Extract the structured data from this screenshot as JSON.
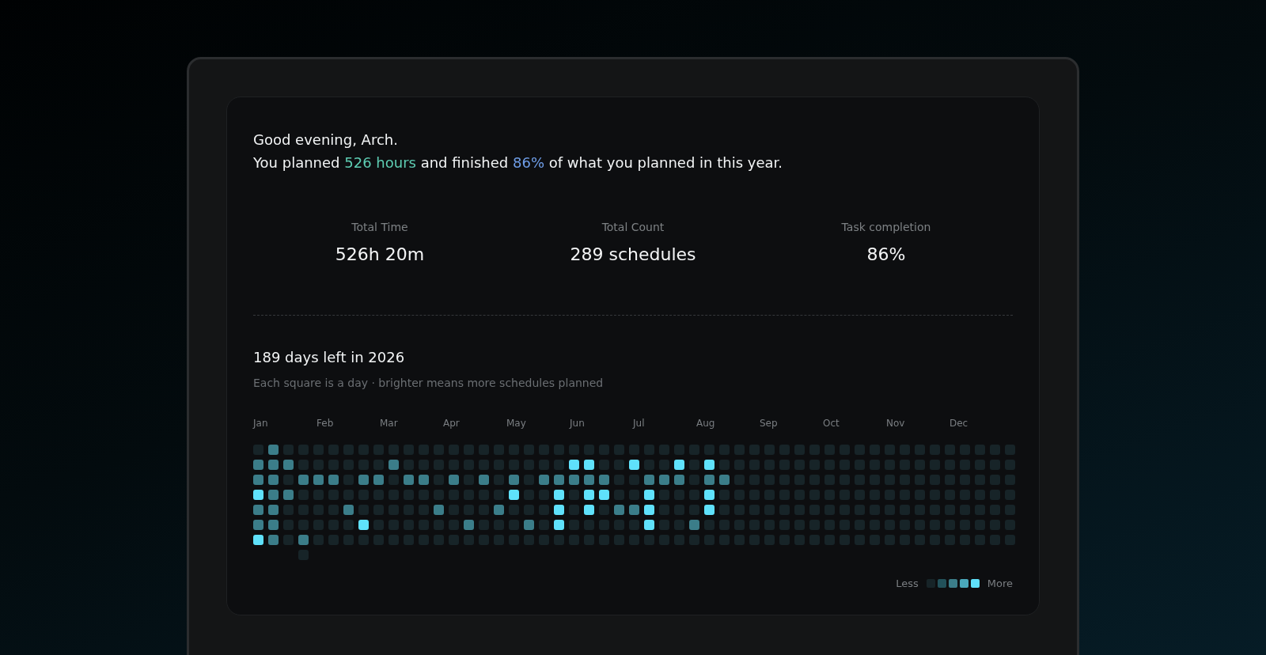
{
  "greeting": "Good evening, Arch.",
  "summary": [
    {
      "text": "You planned ",
      "color": "#f2f4f5"
    },
    {
      "text": "526 hours",
      "color": "#5ecdb3"
    },
    {
      "text": " and finished ",
      "color": "#f2f4f5"
    },
    {
      "text": "86%",
      "color": "#6f9ee8"
    },
    {
      "text": " of what you planned in this year.",
      "color": "#f2f4f5"
    }
  ],
  "stats": [
    {
      "label": "Total Time",
      "value": "526h 20m"
    },
    {
      "label": "Total Count",
      "value": "289 schedules"
    },
    {
      "label": "Task completion",
      "value": "86%"
    }
  ],
  "heatmap": {
    "title": "189 days left in 2026",
    "subtitle": "Each square is a day · brighter means more schedules planned",
    "months": [
      "Jan",
      "Feb",
      "Mar",
      "Apr",
      "May",
      "Jun",
      "Jul",
      "Aug",
      "Sep",
      "Oct",
      "Nov",
      "Dec"
    ],
    "weeks": [
      [
        {
          "color": "#172428"
        },
        {
          "color": "#3b7d89"
        },
        {
          "color": "#3b7d89"
        },
        {
          "color": "#5fe1fb"
        },
        {
          "color": "#3b7d89"
        },
        {
          "color": "#3b7d89"
        },
        {
          "color": "#5fe1fb"
        }
      ],
      [
        {
          "color": "#3b7d89"
        },
        {
          "color": "#3b7d89"
        },
        {
          "color": "#3b7d89"
        },
        {
          "color": "#3b7d89"
        },
        {
          "color": "#3b7d89"
        },
        {
          "color": "#3b7d89"
        },
        {
          "color": "#3b7d89"
        }
      ],
      [
        {
          "color": "#172428"
        },
        {
          "color": "#3b7d89"
        },
        {
          "color": "#172428"
        },
        {
          "color": "#3b7d89"
        },
        {
          "color": "#172428"
        },
        {
          "color": "#172428"
        },
        {
          "color": "#172428"
        }
      ],
      [
        {
          "color": "#172428"
        },
        {
          "color": "#172428"
        },
        {
          "color": "#3b7d89"
        },
        {
          "color": "#172428"
        },
        {
          "color": "#172428"
        },
        {
          "color": "#172428"
        },
        {
          "color": "#3b7d89"
        },
        {
          "color": "#172428"
        }
      ],
      [
        {
          "color": "#172428"
        },
        {
          "color": "#172428"
        },
        {
          "color": "#3b7d89"
        },
        {
          "color": "#172428"
        },
        {
          "color": "#172428"
        },
        {
          "color": "#172428"
        },
        {
          "color": "#172428"
        }
      ],
      [
        {
          "color": "#172428"
        },
        {
          "color": "#172428"
        },
        {
          "color": "#3b7d89"
        },
        {
          "color": "#172428"
        },
        {
          "color": "#172428"
        },
        {
          "color": "#172428"
        },
        {
          "color": "#172428"
        }
      ],
      [
        {
          "color": "#172428"
        },
        {
          "color": "#172428"
        },
        {
          "color": "#172428"
        },
        {
          "color": "#172428"
        },
        {
          "color": "#3b7d89"
        },
        {
          "color": "#172428"
        },
        {
          "color": "#172428"
        }
      ],
      [
        {
          "color": "#172428"
        },
        {
          "color": "#172428"
        },
        {
          "color": "#3b7d89"
        },
        {
          "color": "#172428"
        },
        {
          "color": "#172428"
        },
        {
          "color": "#5fe1fb"
        },
        {
          "color": "#172428"
        }
      ],
      [
        {
          "color": "#172428"
        },
        {
          "color": "#172428"
        },
        {
          "color": "#3b7d89"
        },
        {
          "color": "#172428"
        },
        {
          "color": "#172428"
        },
        {
          "color": "#172428"
        },
        {
          "color": "#172428"
        }
      ],
      [
        {
          "color": "#172428"
        },
        {
          "color": "#3b7d89"
        },
        {
          "color": "#172428"
        },
        {
          "color": "#172428"
        },
        {
          "color": "#172428"
        },
        {
          "color": "#172428"
        },
        {
          "color": "#172428"
        }
      ],
      [
        {
          "color": "#172428"
        },
        {
          "color": "#172428"
        },
        {
          "color": "#3b7d89"
        },
        {
          "color": "#172428"
        },
        {
          "color": "#172428"
        },
        {
          "color": "#172428"
        },
        {
          "color": "#172428"
        }
      ],
      [
        {
          "color": "#172428"
        },
        {
          "color": "#172428"
        },
        {
          "color": "#3b7d89"
        },
        {
          "color": "#172428"
        },
        {
          "color": "#172428"
        },
        {
          "color": "#172428"
        },
        {
          "color": "#172428"
        }
      ],
      [
        {
          "color": "#172428"
        },
        {
          "color": "#172428"
        },
        {
          "color": "#172428"
        },
        {
          "color": "#172428"
        },
        {
          "color": "#3b7d89"
        },
        {
          "color": "#172428"
        },
        {
          "color": "#172428"
        }
      ],
      [
        {
          "color": "#172428"
        },
        {
          "color": "#172428"
        },
        {
          "color": "#3b7d89"
        },
        {
          "color": "#172428"
        },
        {
          "color": "#172428"
        },
        {
          "color": "#172428"
        },
        {
          "color": "#172428"
        }
      ],
      [
        {
          "color": "#172428"
        },
        {
          "color": "#172428"
        },
        {
          "color": "#172428"
        },
        {
          "color": "#172428"
        },
        {
          "color": "#172428"
        },
        {
          "color": "#3b7d89"
        },
        {
          "color": "#172428"
        }
      ],
      [
        {
          "color": "#172428"
        },
        {
          "color": "#172428"
        },
        {
          "color": "#3b7d89"
        },
        {
          "color": "#172428"
        },
        {
          "color": "#172428"
        },
        {
          "color": "#172428"
        },
        {
          "color": "#172428"
        }
      ],
      [
        {
          "color": "#172428"
        },
        {
          "color": "#172428"
        },
        {
          "color": "#172428"
        },
        {
          "color": "#172428"
        },
        {
          "color": "#3b7d89"
        },
        {
          "color": "#172428"
        },
        {
          "color": "#172428"
        }
      ],
      [
        {
          "color": "#172428"
        },
        {
          "color": "#172428"
        },
        {
          "color": "#3b7d89"
        },
        {
          "color": "#5fe1fb"
        },
        {
          "color": "#172428"
        },
        {
          "color": "#172428"
        },
        {
          "color": "#172428"
        }
      ],
      [
        {
          "color": "#172428"
        },
        {
          "color": "#172428"
        },
        {
          "color": "#172428"
        },
        {
          "color": "#172428"
        },
        {
          "color": "#172428"
        },
        {
          "color": "#3b7d89"
        },
        {
          "color": "#172428"
        }
      ],
      [
        {
          "color": "#172428"
        },
        {
          "color": "#172428"
        },
        {
          "color": "#3b7d89"
        },
        {
          "color": "#172428"
        },
        {
          "color": "#172428"
        },
        {
          "color": "#172428"
        },
        {
          "color": "#172428"
        }
      ],
      [
        {
          "color": "#172428"
        },
        {
          "color": "#172428"
        },
        {
          "color": "#3b7d89"
        },
        {
          "color": "#5fe1fb"
        },
        {
          "color": "#5fe1fb"
        },
        {
          "color": "#5fe1fb"
        },
        {
          "color": "#172428"
        }
      ],
      [
        {
          "color": "#172428"
        },
        {
          "color": "#5fe1fb"
        },
        {
          "color": "#3b7d89"
        },
        {
          "color": "#172428"
        },
        {
          "color": "#172428"
        },
        {
          "color": "#172428"
        },
        {
          "color": "#172428"
        }
      ],
      [
        {
          "color": "#172428"
        },
        {
          "color": "#5fe1fb"
        },
        {
          "color": "#3b7d89"
        },
        {
          "color": "#5fe1fb"
        },
        {
          "color": "#5fe1fb"
        },
        {
          "color": "#172428"
        },
        {
          "color": "#172428"
        }
      ],
      [
        {
          "color": "#172428"
        },
        {
          "color": "#172428"
        },
        {
          "color": "#3b7d89"
        },
        {
          "color": "#5fe1fb"
        },
        {
          "color": "#172428"
        },
        {
          "color": "#172428"
        },
        {
          "color": "#172428"
        }
      ],
      [
        {
          "color": "#172428"
        },
        {
          "color": "#172428"
        },
        {
          "color": "#172428"
        },
        {
          "color": "#172428"
        },
        {
          "color": "#3b7d89"
        },
        {
          "color": "#172428"
        },
        {
          "color": "#172428"
        }
      ],
      [
        {
          "color": "#172428"
        },
        {
          "color": "#5fe1fb"
        },
        {
          "color": "#172428"
        },
        {
          "color": "#172428"
        },
        {
          "color": "#3b7d89"
        },
        {
          "color": "#172428"
        },
        {
          "color": "#172428"
        }
      ],
      [
        {
          "color": "#172428"
        },
        {
          "color": "#172428"
        },
        {
          "color": "#3b7d89"
        },
        {
          "color": "#5fe1fb"
        },
        {
          "color": "#5fe1fb"
        },
        {
          "color": "#5fe1fb"
        },
        {
          "color": "#172428"
        }
      ],
      [
        {
          "color": "#172428"
        },
        {
          "color": "#172428"
        },
        {
          "color": "#3b7d89"
        },
        {
          "color": "#172428"
        },
        {
          "color": "#172428"
        },
        {
          "color": "#172428"
        },
        {
          "color": "#172428"
        }
      ],
      [
        {
          "color": "#172428"
        },
        {
          "color": "#5fe1fb"
        },
        {
          "color": "#3b7d89"
        },
        {
          "color": "#172428"
        },
        {
          "color": "#172428"
        },
        {
          "color": "#172428"
        },
        {
          "color": "#172428"
        }
      ],
      [
        {
          "color": "#172428"
        },
        {
          "color": "#172428"
        },
        {
          "color": "#172428"
        },
        {
          "color": "#172428"
        },
        {
          "color": "#172428"
        },
        {
          "color": "#3b7d89"
        },
        {
          "color": "#172428"
        }
      ],
      [
        {
          "color": "#172428"
        },
        {
          "color": "#5fe1fb"
        },
        {
          "color": "#3b7d89"
        },
        {
          "color": "#5fe1fb"
        },
        {
          "color": "#5fe1fb"
        },
        {
          "color": "#172428"
        },
        {
          "color": "#172428"
        }
      ],
      [
        {
          "color": "#172428"
        },
        {
          "color": "#172428"
        },
        {
          "color": "#3b7d89"
        },
        {
          "color": "#172428"
        },
        {
          "color": "#172428"
        },
        {
          "color": "#172428"
        },
        {
          "color": "#172428"
        }
      ],
      [
        {
          "color": "#172428"
        },
        {
          "color": "#172428"
        },
        {
          "color": "#172428"
        },
        {
          "color": "#172428"
        },
        {
          "color": "#172428"
        },
        {
          "color": "#172428"
        },
        {
          "color": "#172428"
        }
      ],
      [
        {
          "color": "#172428"
        },
        {
          "color": "#172428"
        },
        {
          "color": "#172428"
        },
        {
          "color": "#172428"
        },
        {
          "color": "#172428"
        },
        {
          "color": "#172428"
        },
        {
          "color": "#172428"
        }
      ],
      [
        {
          "color": "#172428"
        },
        {
          "color": "#172428"
        },
        {
          "color": "#172428"
        },
        {
          "color": "#172428"
        },
        {
          "color": "#172428"
        },
        {
          "color": "#172428"
        },
        {
          "color": "#172428"
        }
      ],
      [
        {
          "color": "#172428"
        },
        {
          "color": "#172428"
        },
        {
          "color": "#172428"
        },
        {
          "color": "#172428"
        },
        {
          "color": "#172428"
        },
        {
          "color": "#172428"
        },
        {
          "color": "#172428"
        }
      ],
      [
        {
          "color": "#172428"
        },
        {
          "color": "#172428"
        },
        {
          "color": "#172428"
        },
        {
          "color": "#172428"
        },
        {
          "color": "#172428"
        },
        {
          "color": "#172428"
        },
        {
          "color": "#172428"
        }
      ],
      [
        {
          "color": "#172428"
        },
        {
          "color": "#172428"
        },
        {
          "color": "#172428"
        },
        {
          "color": "#172428"
        },
        {
          "color": "#172428"
        },
        {
          "color": "#172428"
        },
        {
          "color": "#172428"
        }
      ],
      [
        {
          "color": "#172428"
        },
        {
          "color": "#172428"
        },
        {
          "color": "#172428"
        },
        {
          "color": "#172428"
        },
        {
          "color": "#172428"
        },
        {
          "color": "#172428"
        },
        {
          "color": "#172428"
        }
      ],
      [
        {
          "color": "#172428"
        },
        {
          "color": "#172428"
        },
        {
          "color": "#172428"
        },
        {
          "color": "#172428"
        },
        {
          "color": "#172428"
        },
        {
          "color": "#172428"
        },
        {
          "color": "#172428"
        }
      ],
      [
        {
          "color": "#172428"
        },
        {
          "color": "#172428"
        },
        {
          "color": "#172428"
        },
        {
          "color": "#172428"
        },
        {
          "color": "#172428"
        },
        {
          "color": "#172428"
        },
        {
          "color": "#172428"
        }
      ],
      [
        {
          "color": "#172428"
        },
        {
          "color": "#172428"
        },
        {
          "color": "#172428"
        },
        {
          "color": "#172428"
        },
        {
          "color": "#172428"
        },
        {
          "color": "#172428"
        },
        {
          "color": "#172428"
        }
      ],
      [
        {
          "color": "#172428"
        },
        {
          "color": "#172428"
        },
        {
          "color": "#172428"
        },
        {
          "color": "#172428"
        },
        {
          "color": "#172428"
        },
        {
          "color": "#172428"
        },
        {
          "color": "#172428"
        }
      ],
      [
        {
          "color": "#172428"
        },
        {
          "color": "#172428"
        },
        {
          "color": "#172428"
        },
        {
          "color": "#172428"
        },
        {
          "color": "#172428"
        },
        {
          "color": "#172428"
        },
        {
          "color": "#172428"
        }
      ],
      [
        {
          "color": "#172428"
        },
        {
          "color": "#172428"
        },
        {
          "color": "#172428"
        },
        {
          "color": "#172428"
        },
        {
          "color": "#172428"
        },
        {
          "color": "#172428"
        },
        {
          "color": "#172428"
        }
      ],
      [
        {
          "color": "#172428"
        },
        {
          "color": "#172428"
        },
        {
          "color": "#172428"
        },
        {
          "color": "#172428"
        },
        {
          "color": "#172428"
        },
        {
          "color": "#172428"
        },
        {
          "color": "#172428"
        }
      ],
      [
        {
          "color": "#172428"
        },
        {
          "color": "#172428"
        },
        {
          "color": "#172428"
        },
        {
          "color": "#172428"
        },
        {
          "color": "#172428"
        },
        {
          "color": "#172428"
        },
        {
          "color": "#172428"
        }
      ],
      [
        {
          "color": "#172428"
        },
        {
          "color": "#172428"
        },
        {
          "color": "#172428"
        },
        {
          "color": "#172428"
        },
        {
          "color": "#172428"
        },
        {
          "color": "#172428"
        },
        {
          "color": "#172428"
        }
      ],
      [
        {
          "color": "#172428"
        },
        {
          "color": "#172428"
        },
        {
          "color": "#172428"
        },
        {
          "color": "#172428"
        },
        {
          "color": "#172428"
        },
        {
          "color": "#172428"
        },
        {
          "color": "#172428"
        }
      ],
      [
        {
          "color": "#172428"
        },
        {
          "color": "#172428"
        },
        {
          "color": "#172428"
        },
        {
          "color": "#172428"
        },
        {
          "color": "#172428"
        },
        {
          "color": "#172428"
        },
        {
          "color": "#172428"
        }
      ],
      [
        {
          "color": "#172428"
        },
        {
          "color": "#172428"
        },
        {
          "color": "#172428"
        },
        {
          "color": "#172428"
        },
        {
          "color": "#172428"
        },
        {
          "color": "#172428"
        },
        {
          "color": "#172428"
        }
      ]
    ],
    "legend": {
      "less": "Less",
      "more": "More",
      "steps": [
        {
          "color": "#172428"
        },
        {
          "color": "#22515a"
        },
        {
          "color": "#3b7d89"
        },
        {
          "color": "#4aa8bb"
        },
        {
          "color": "#5fe1fb"
        }
      ]
    }
  }
}
